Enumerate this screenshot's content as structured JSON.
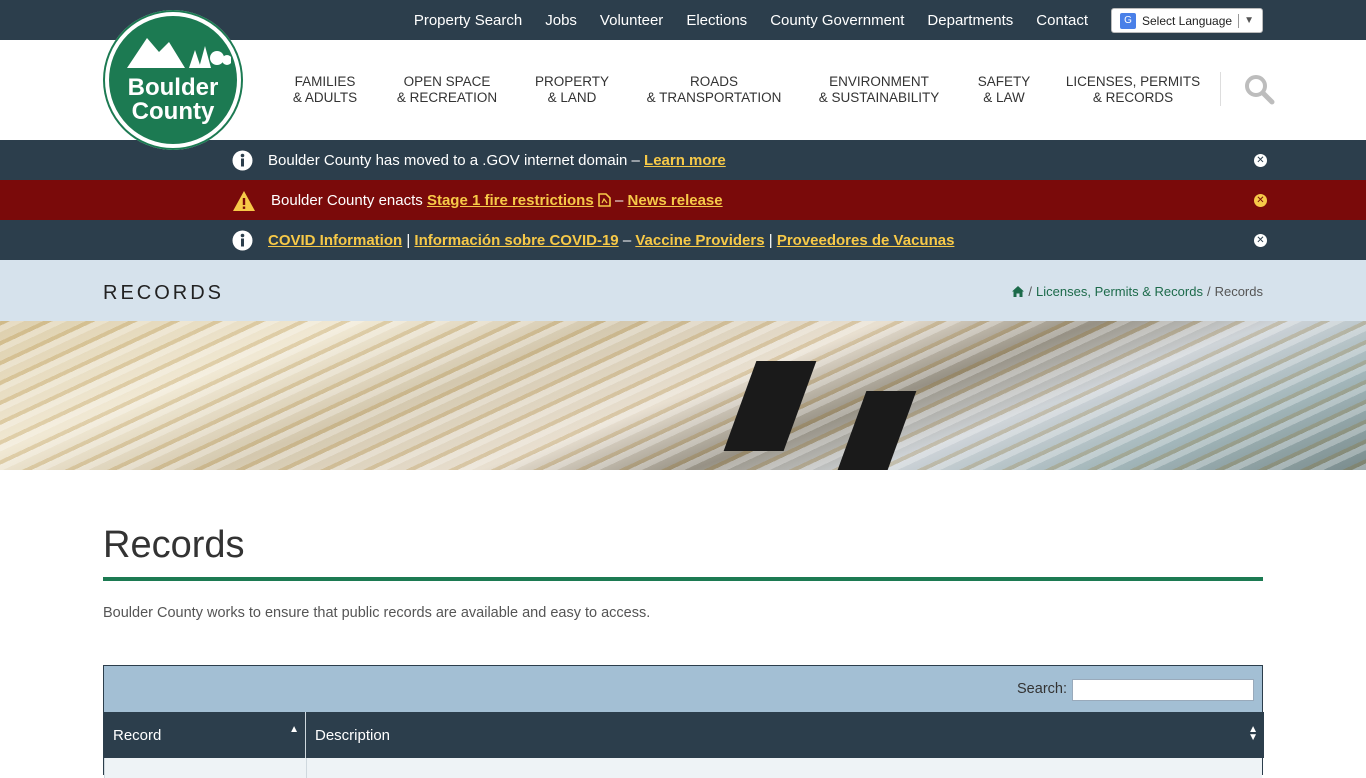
{
  "topnav": {
    "links": [
      "Property Search",
      "Jobs",
      "Volunteer",
      "Elections",
      "County Government",
      "Departments",
      "Contact"
    ],
    "language": "Select Language"
  },
  "logo": {
    "line1": "Boulder",
    "line2": "County"
  },
  "mainnav": [
    {
      "line1": "FAMILIES",
      "line2": "& ADULTS"
    },
    {
      "line1": "OPEN SPACE",
      "line2": "& RECREATION"
    },
    {
      "line1": "PROPERTY",
      "line2": "& LAND"
    },
    {
      "line1": "ROADS",
      "line2": "& TRANSPORTATION"
    },
    {
      "line1": "ENVIRONMENT",
      "line2": "& SUSTAINABILITY"
    },
    {
      "line1": "SAFETY",
      "line2": "& LAW"
    },
    {
      "line1": "LICENSES, PERMITS",
      "line2": "& RECORDS"
    }
  ],
  "alerts": {
    "gov": {
      "text": "Boulder County has moved to a .GOV internet domain –",
      "link": "Learn more"
    },
    "fire": {
      "text": "Boulder County enacts",
      "link1": "Stage 1 fire restrictions",
      "dash": "–",
      "link2": "News release"
    },
    "covid": {
      "link1": "COVID Information",
      "sep1": "|",
      "link2": "Información sobre COVID-19",
      "dash": "–",
      "link3": "Vaccine Providers",
      "sep2": "|",
      "link4": "Proveedores de Vacunas"
    }
  },
  "titlebar": {
    "title": "RECORDS",
    "breadcrumb": {
      "sep": "/",
      "parent": "Licenses, Permits & Records",
      "current": "Records"
    }
  },
  "page": {
    "heading": "Records",
    "intro": "Boulder County works to ensure that public records are available and easy to access."
  },
  "table": {
    "search_label": "Search:",
    "columns": [
      "Record",
      "Description"
    ]
  },
  "colors": {
    "brand_green": "#1c7a52",
    "navy": "#2c3e4c",
    "alert_red": "#7a0a0a",
    "link_yellow": "#f7c948"
  }
}
